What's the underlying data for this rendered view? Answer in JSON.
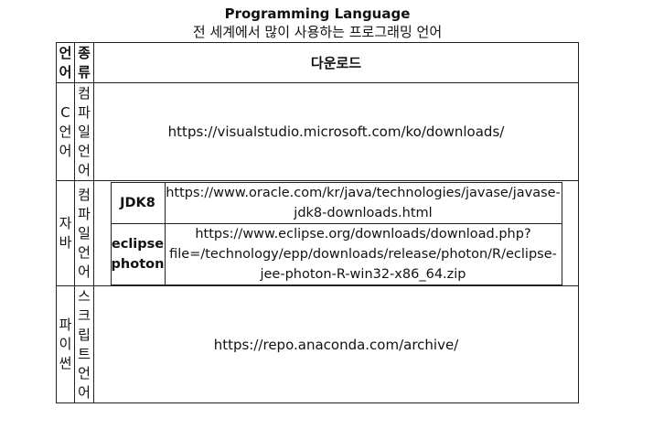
{
  "title": "Programming Language",
  "subtitle": "전 세계에서 많이 사용하는 프로그래밍 언어",
  "table": {
    "header": {
      "language": "언어",
      "kind": "종류",
      "download": "다운로드"
    },
    "rows": [
      {
        "language": "C언어",
        "kind": "컴파일언어",
        "url": "https://visualstudio.microsoft.com/ko/downloads/"
      },
      {
        "language": "자바",
        "kind": "컴파일언어",
        "downloads": [
          {
            "label": "JDK8",
            "url": "https://www.oracle.com/kr/java/technologies/javase/javase-jdk8-downloads.html"
          },
          {
            "label": "eclipse photon",
            "url": "https://www.eclipse.org/downloads/download.php?file=/technology/epp/downloads/release/photon/R/eclipse-jee-photon-R-win32-x86_64.zip"
          }
        ]
      },
      {
        "language": "파이썬",
        "kind": "스크립트언어",
        "url": "https://repo.anaconda.com/archive/"
      }
    ]
  }
}
